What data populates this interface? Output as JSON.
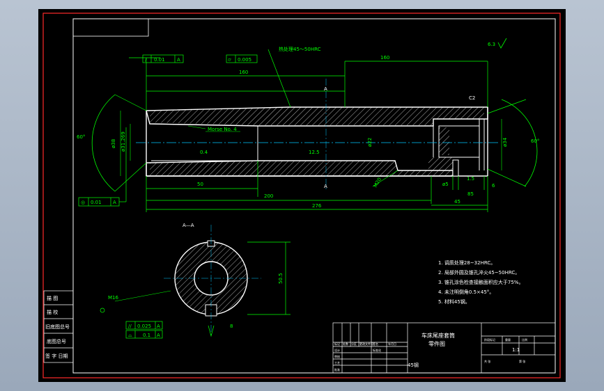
{
  "drawing": {
    "part_name": "车床尾座套筒",
    "doc_type": "零件图",
    "scale": "1:1",
    "material": "45钢",
    "notes": [
      "1. 调质处理28~32HRC。",
      "2. 局部外圆及锥孔淬火45~50HRC。",
      "3. 锥孔涂色检查接触面积应大于75%。",
      "4. 未注明倒角0.5×45°。",
      "5. 材料45钢。"
    ],
    "heat_treat": "热处理45～50HRC",
    "taper": "Morse No. 4",
    "section_label": "A—A",
    "surface_finish_ref": "6.3",
    "angle_left": "60°",
    "angle_right": "60°",
    "dims": {
      "d_160_left": "160",
      "d_160_right": "160",
      "d_50": "50",
      "d_200": "200",
      "d_276": "276",
      "d_85": "85",
      "d_45": "45",
      "d_1_5": "1.5",
      "d_6": "6",
      "d_c2": "C2",
      "d_m20": "M20",
      "d_phi_left": "ø31.269",
      "d_phi_38": "ø38",
      "d_phi_34": "ø34",
      "d_phi_22": "ø22",
      "d_section": "50.5",
      "d_slot": "8",
      "d_m16": "M16"
    },
    "tolerances": {
      "top1": {
        "sym": "/",
        "val": "0.01",
        "ref": "A"
      },
      "top2": {
        "sym": "⌭",
        "val": "0.005",
        "ref": ""
      },
      "left": {
        "sym": "◎",
        "val": "0.01",
        "ref": "A"
      },
      "sec1": {
        "sym": "//",
        "val": "0.025",
        "ref": "A"
      },
      "sec2": {
        "sym": "⌓",
        "val": "0.1",
        "ref": "A"
      }
    },
    "side_table": [
      "描 图",
      "描 校",
      "旧底图总号",
      "底图总号",
      "签 字  日期"
    ],
    "title_block_labels": [
      "标记",
      "处数",
      "分区",
      "更改文件号",
      "签名",
      "年月日",
      "设计",
      "审核",
      "工艺",
      "标准化",
      "批准",
      "阶段标记",
      "重量",
      "比例",
      "共 张",
      "第 张"
    ]
  }
}
